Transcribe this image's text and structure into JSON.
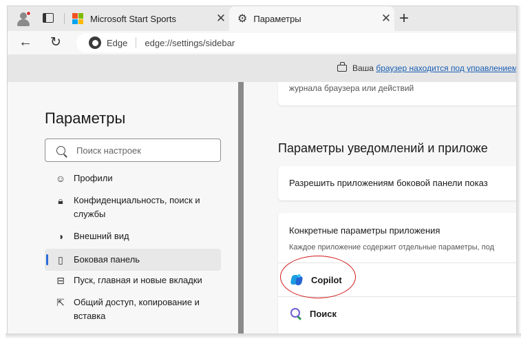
{
  "tabs": [
    {
      "title": "Microsoft Start Sports",
      "close": "✕"
    },
    {
      "title": "Параметры",
      "close": "✕"
    }
  ],
  "new_tab_label": "+",
  "address": {
    "badge": "Edge",
    "url": "edge://settings/sidebar"
  },
  "infobar": {
    "prefix": "Ваша",
    "link": "браузер находится под управлением"
  },
  "settings": {
    "title": "Параметры",
    "search_placeholder": "Поиск настроек",
    "nav": [
      {
        "label": "Профили",
        "icon": "profile-icon"
      },
      {
        "label": "Конфиденциальность, поиск и службы",
        "icon": "lock-icon"
      },
      {
        "label": "Внешний вид",
        "icon": "palette-icon"
      },
      {
        "label": "Боковая панель",
        "icon": "sidebar-icon"
      },
      {
        "label": "Пуск, главная и новые вкладки",
        "icon": "home-icon"
      },
      {
        "label": "Общий доступ, копирование и вставка",
        "icon": "share-icon"
      }
    ]
  },
  "content": {
    "top_card_text": "журнала браузера или действий",
    "section_title": "Параметры уведомлений и приложе",
    "allow_row": "Разрешить приложениям боковой панели показ",
    "app_card_title": "Конкретные параметры приложения",
    "app_card_sub": "Каждое приложение содержит отдельные параметры, под",
    "apps": [
      {
        "label": "Copilot",
        "icon": "copilot-icon"
      },
      {
        "label": "Поиск",
        "icon": "search-app-icon"
      }
    ]
  },
  "colors": {
    "accent": "#2b6bd9",
    "highlight": "#d01818",
    "link": "#1a5fb4"
  }
}
